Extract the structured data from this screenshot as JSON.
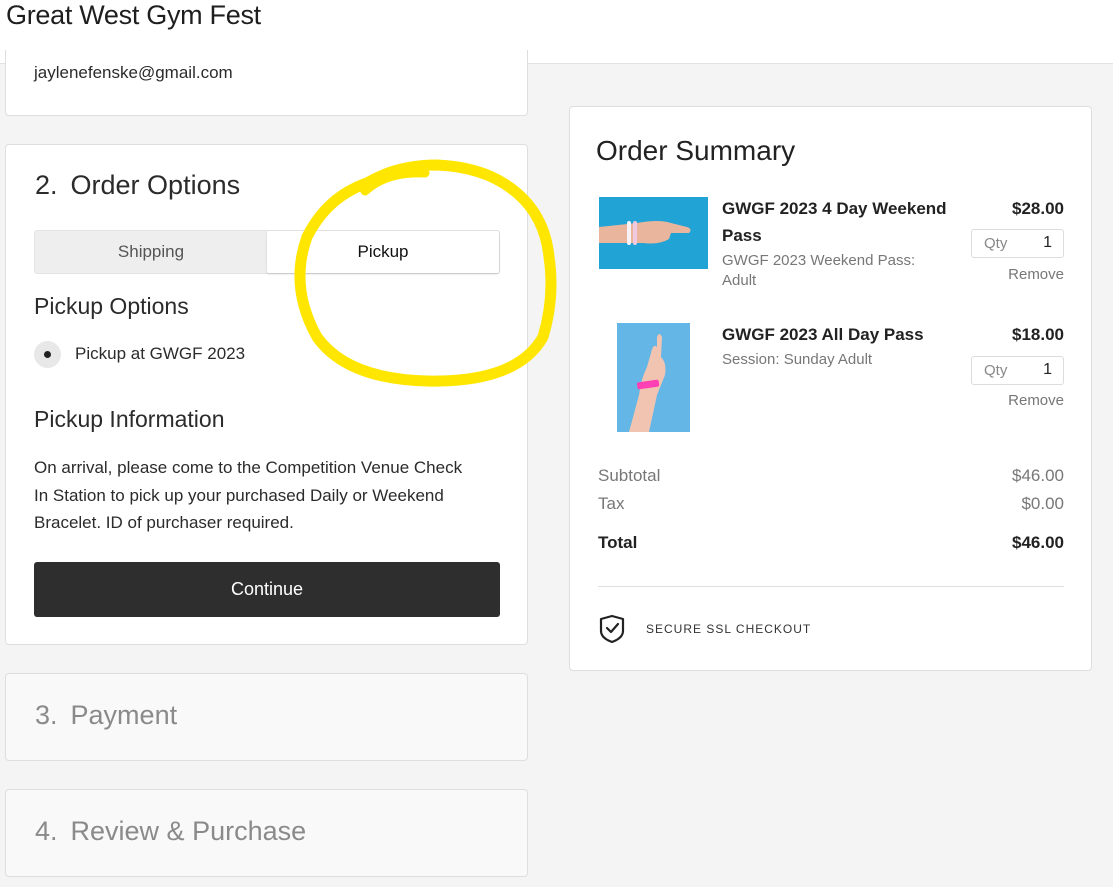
{
  "header": {
    "site_title": "Great West Gym Fest"
  },
  "contact": {
    "email": "jaylenefenske@gmail.com"
  },
  "order_options": {
    "number": "2.",
    "title": "Order Options",
    "tabs": [
      {
        "label": "Shipping",
        "selected": false
      },
      {
        "label": "Pickup",
        "selected": true
      }
    ],
    "pickup_options_heading": "Pickup Options",
    "pickup_option_label": "Pickup at GWGF 2023",
    "pickup_info_heading": "Pickup Information",
    "pickup_info_text": "On arrival, please come to the Competition Venue Check In Station to pick up your purchased Daily or Weekend Bracelet. ID of purchaser required.",
    "continue_label": "Continue"
  },
  "payment": {
    "number": "3.",
    "title": "Payment"
  },
  "review": {
    "number": "4.",
    "title": "Review & Purchase"
  },
  "order_summary": {
    "title": "Order Summary",
    "items": [
      {
        "name": "GWGF 2023 4 Day Weekend Pass",
        "description": "GWGF 2023 Weekend Pass: Adult",
        "price": "$28.00",
        "qty_label": "Qty",
        "qty": "1",
        "remove_label": "Remove"
      },
      {
        "name": "GWGF 2023 All Day Pass",
        "description": "Session: Sunday Adult",
        "price": "$18.00",
        "qty_label": "Qty",
        "qty": "1",
        "remove_label": "Remove"
      }
    ],
    "subtotal_label": "Subtotal",
    "subtotal": "$46.00",
    "tax_label": "Tax",
    "tax": "$0.00",
    "total_label": "Total",
    "total": "$46.00",
    "secure_label": "SECURE SSL CHECKOUT"
  },
  "colors": {
    "highlight": "#ffe600",
    "button_dark": "#2e2e2e",
    "item1_image_bg": "#22a3d6",
    "item2_image_bg": "#63b6e6",
    "wristband_pink": "#ff3fb4"
  }
}
